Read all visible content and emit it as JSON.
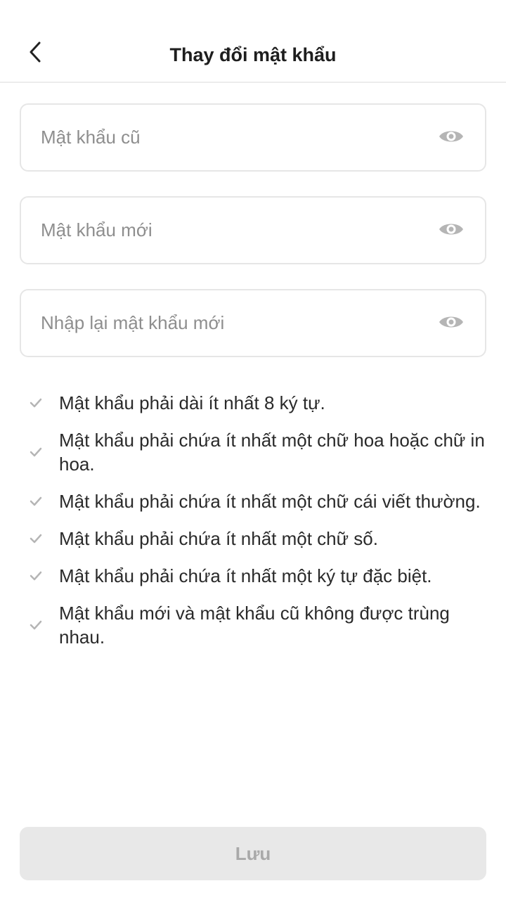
{
  "header": {
    "title": "Thay đổi mật khẩu",
    "back_icon": "chevron-left-icon"
  },
  "form": {
    "fields": [
      {
        "placeholder": "Mật khẩu cũ",
        "value": "",
        "icon": "eye-icon"
      },
      {
        "placeholder": "Mật khẩu mới",
        "value": "",
        "icon": "eye-icon"
      },
      {
        "placeholder": "Nhập lại mật khẩu mới",
        "value": "",
        "icon": "eye-icon"
      }
    ]
  },
  "rules": [
    {
      "text": "Mật khẩu phải dài ít nhất 8 ký tự.",
      "icon": "check-icon"
    },
    {
      "text": "Mật khẩu phải chứa ít nhất một chữ hoa hoặc chữ in hoa.",
      "icon": "check-icon"
    },
    {
      "text": "Mật khẩu phải chứa ít nhất một chữ cái viết thường.",
      "icon": "check-icon"
    },
    {
      "text": "Mật khẩu phải chứa ít nhất một chữ số.",
      "icon": "check-icon"
    },
    {
      "text": "Mật khẩu phải chứa ít nhất một ký tự đặc biệt.",
      "icon": "check-icon"
    },
    {
      "text": "Mật khẩu mới và mật khẩu cũ không được trùng nhau.",
      "icon": "check-icon"
    }
  ],
  "footer": {
    "save_label": "Lưu",
    "save_enabled": false
  },
  "colors": {
    "border": "#e6e6e6",
    "placeholder": "#8e8e8e",
    "icon_gray": "#b5b5b5",
    "button_disabled_bg": "#e8e8e8",
    "button_disabled_text": "#a9a9a9"
  }
}
